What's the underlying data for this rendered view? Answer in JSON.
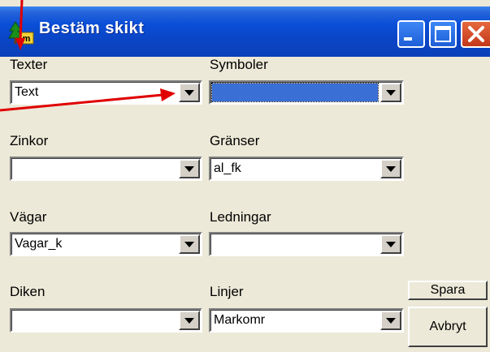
{
  "window": {
    "title": "Bestäm skikt",
    "app_icon": "tree-mi-icon"
  },
  "window_buttons": {
    "minimize": "minimize-icon",
    "maximize": "maximize-icon",
    "close": "close-icon"
  },
  "fields": {
    "texter": {
      "label": "Texter",
      "value": "Text"
    },
    "symboler": {
      "label": "Symboler",
      "value": "",
      "selected_highlight": true
    },
    "zinkor": {
      "label": "Zinkor",
      "value": ""
    },
    "granser": {
      "label": "Gränser",
      "value": "al_fk"
    },
    "vagar": {
      "label": "Vägar",
      "value": "Vagar_k"
    },
    "ledningar": {
      "label": "Ledningar",
      "value": ""
    },
    "diken": {
      "label": "Diken",
      "value": ""
    },
    "linjer": {
      "label": "Linjer",
      "value": "Markomr"
    }
  },
  "buttons": {
    "save": "Spara",
    "cancel": "Avbryt"
  },
  "colors": {
    "titlebar": "#0a46c8",
    "dialog_bg": "#ece9d8",
    "selection": "#3a6fd6",
    "annotation_arrow": "#e00000"
  }
}
